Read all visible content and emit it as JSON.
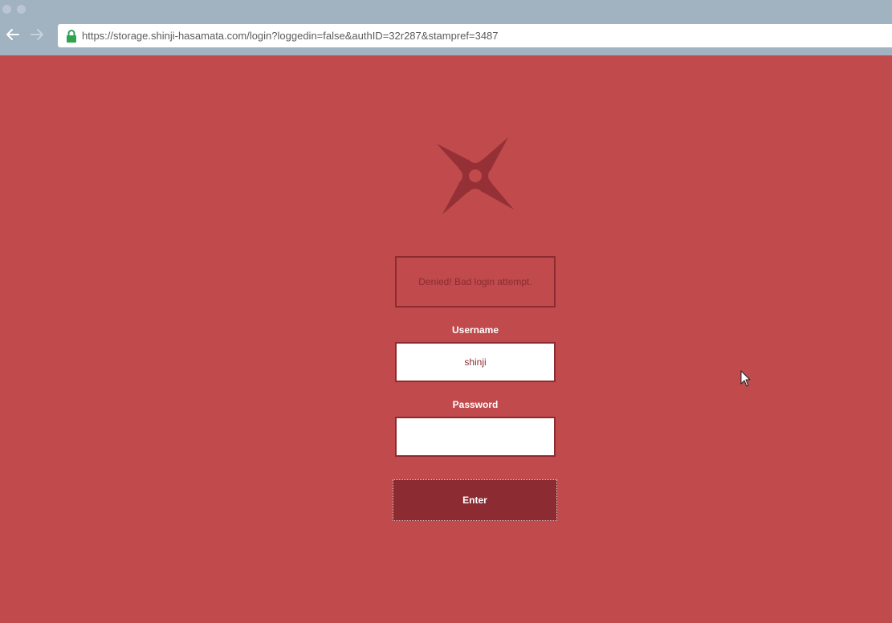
{
  "browser": {
    "url": "https://storage.shinji-hasamata.com/login?loggedin=false&authID=32r287&stampref=3487",
    "back_icon": "arrow-left-icon",
    "forward_icon": "arrow-right-icon",
    "lock_icon": "lock-icon"
  },
  "page": {
    "logo_icon": "shuriken-icon",
    "error_message": "Denied! Bad login attempt.",
    "username": {
      "label": "Username",
      "value": "shinji"
    },
    "password": {
      "label": "Password",
      "value": ""
    },
    "submit_label": "Enter"
  },
  "colors": {
    "background": "#c04a4c",
    "accent_dark": "#8c2c32",
    "chrome": "#a1b2c1",
    "lock_green": "#2ea44f"
  }
}
